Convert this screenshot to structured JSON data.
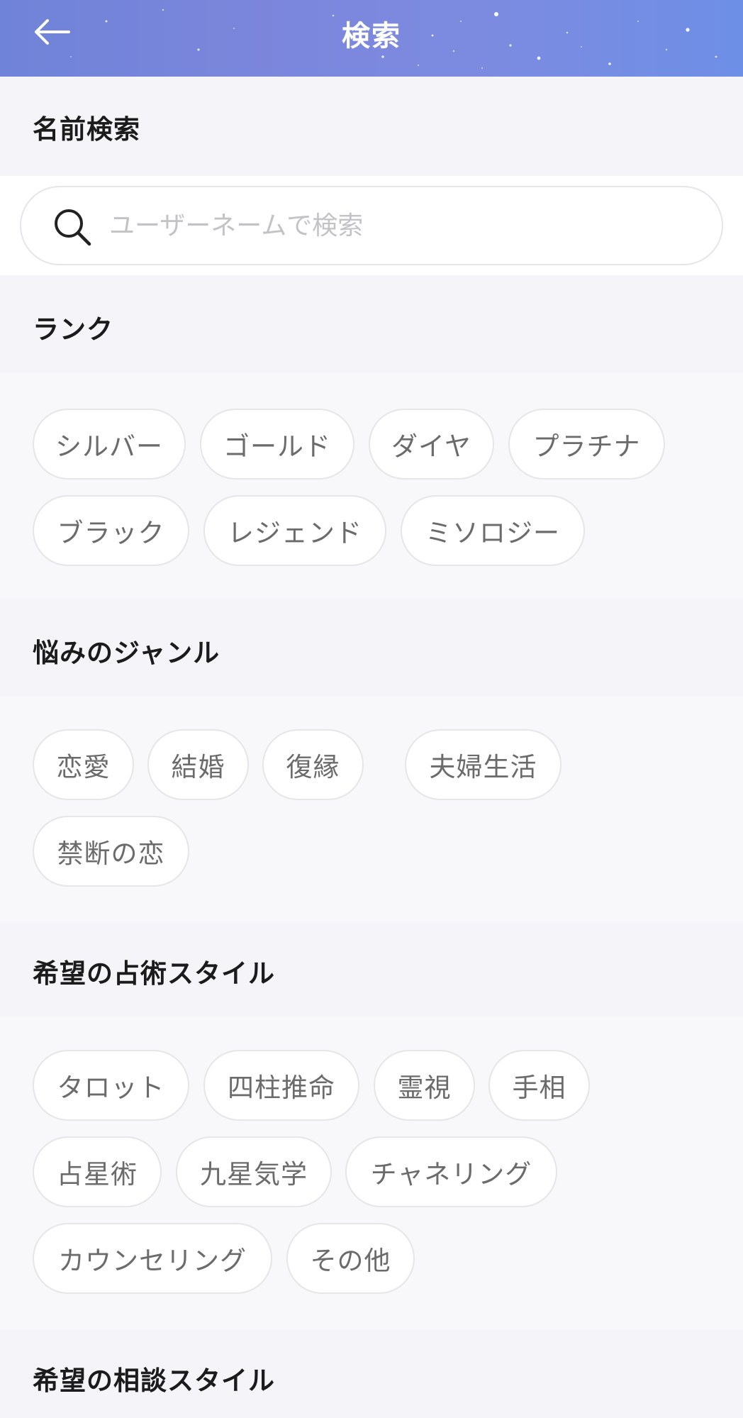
{
  "header": {
    "title": "検索",
    "back_icon": "arrow-left-icon",
    "background_color": "#7b86db"
  },
  "name_search": {
    "heading": "名前検索",
    "placeholder": "ユーザーネームで検索",
    "value": "",
    "icon": "search-icon"
  },
  "rank": {
    "heading": "ランク",
    "options": [
      "シルバー",
      "ゴールド",
      "ダイヤ",
      "プラチナ",
      "ブラック",
      "レジェンド",
      "ミソロジー"
    ]
  },
  "worry_genre": {
    "heading": "悩みのジャンル",
    "options": [
      "恋愛",
      "結婚",
      "復縁",
      "夫婦生活",
      "禁断の恋"
    ]
  },
  "divination_style": {
    "heading": "希望の占術スタイル",
    "options": [
      "タロット",
      "四柱推命",
      "霊視",
      "手相",
      "占星術",
      "九星気学",
      "チャネリング",
      "カウンセリング",
      "その他"
    ]
  },
  "consultation_style": {
    "heading": "希望の相談スタイル"
  }
}
